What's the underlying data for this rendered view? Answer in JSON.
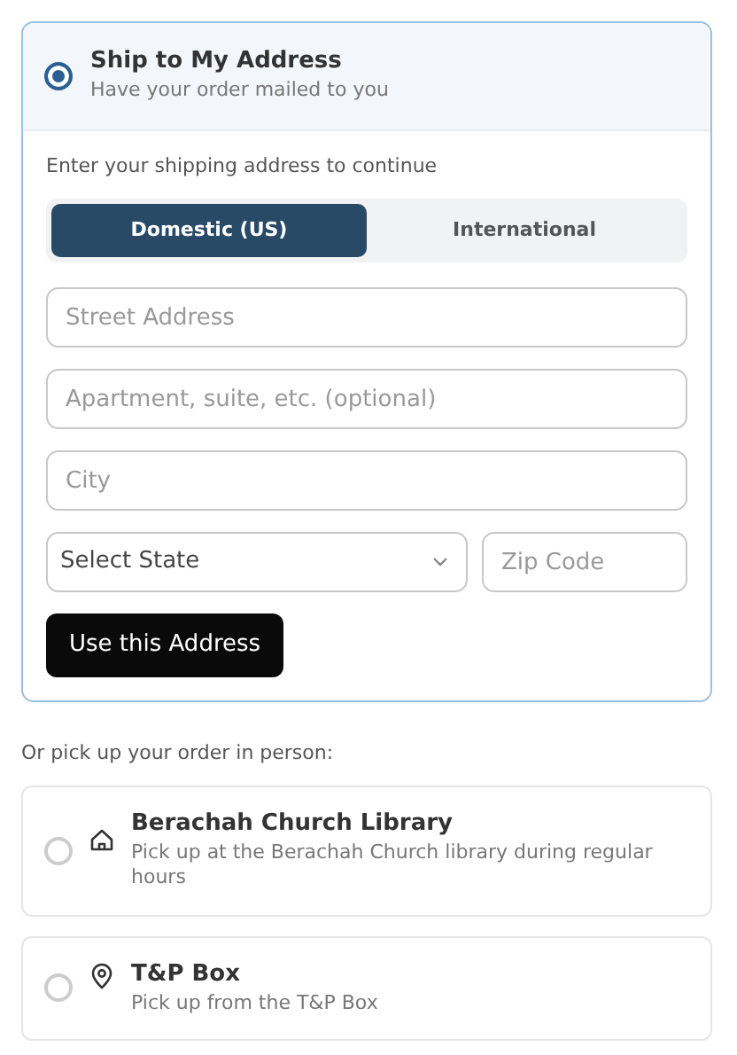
{
  "ship_option": {
    "title": "Ship to My Address",
    "subtitle": "Have your order mailed to you",
    "selected": true
  },
  "address_form": {
    "prompt": "Enter your shipping address to continue",
    "tabs": [
      {
        "label": "Domestic (US)",
        "selected": true
      },
      {
        "label": "International",
        "selected": false
      }
    ],
    "street": {
      "placeholder": "Street Address"
    },
    "apartment": {
      "placeholder": "Apartment, suite, etc. (optional)"
    },
    "city": {
      "placeholder": "City"
    },
    "state": {
      "value": "Select State"
    },
    "zip": {
      "placeholder": "Zip Code"
    },
    "submit_button": "Use this Address"
  },
  "pickup_prompt": "Or pick up your order in person:",
  "pickup_options": [
    {
      "kind": "home",
      "title": "Berachah Church Library",
      "subtitle": "Pick up at the Berachah Church library during regular hours",
      "selected": false
    },
    {
      "kind": "pin",
      "title": "T&P Box",
      "subtitle": "Pick up from the T&P Box",
      "selected": false
    }
  ]
}
